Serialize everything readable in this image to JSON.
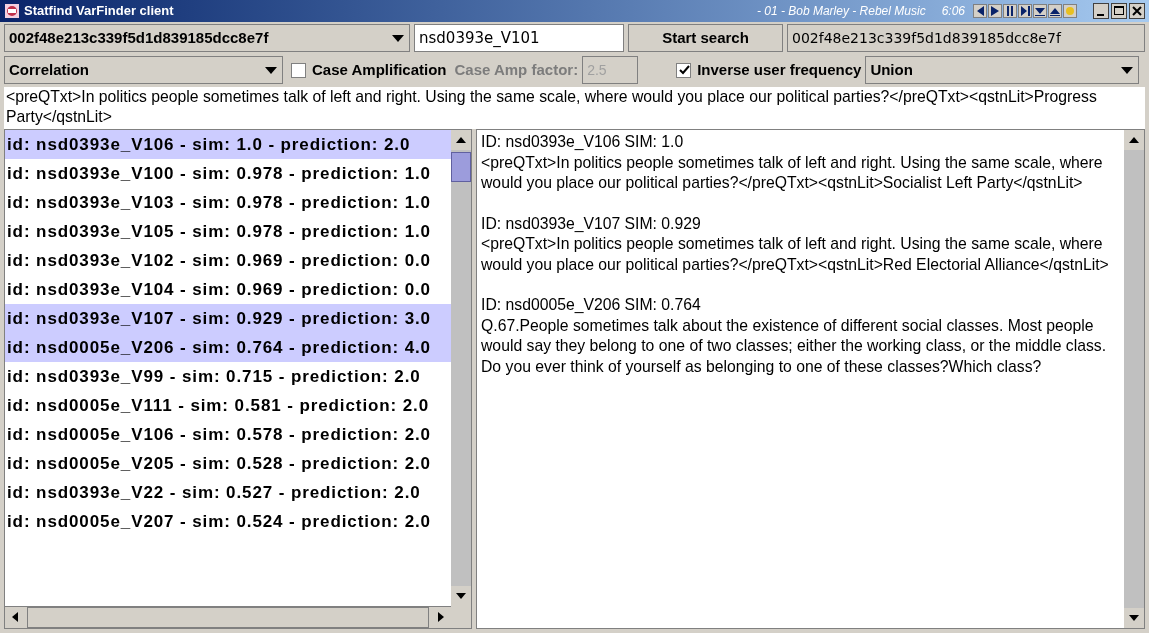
{
  "window": {
    "title": "Statfind VarFinder client",
    "now_playing": "- 01 - Bob Marley - Rebel Music",
    "time": "6:06"
  },
  "search_bar": {
    "user_combo": "002f48e213c339f5d1d839185dcc8e7f",
    "query_field": "nsd0393e_V101",
    "start_button": "Start search",
    "user_field": "002f48e213c339f5d1d839185dcc8e7f"
  },
  "options": {
    "similarity_combo": "Correlation",
    "case_amplification": {
      "label": "Case Amplification",
      "checked": false
    },
    "case_amp_factor": {
      "label": "Case Amp factor:",
      "value": "2.5",
      "disabled": true
    },
    "inverse_user_frequency": {
      "label": "Inverse user frequency",
      "checked": true
    },
    "combine_combo": "Union"
  },
  "query_text": "<preQTxt>In politics people sometimes talk of left and right. Using the same scale, where would you place our political parties?</preQTxt><qstnLit>Progress Party</qstnLit>",
  "results": [
    {
      "label": "id: nsd0393e_V106 - sim: 1.0 - prediction: 2.0",
      "selected": true
    },
    {
      "label": "id: nsd0393e_V100 - sim: 0.978 - prediction: 1.0",
      "selected": false
    },
    {
      "label": "id: nsd0393e_V103 - sim: 0.978 - prediction: 1.0",
      "selected": false
    },
    {
      "label": "id: nsd0393e_V105 - sim: 0.978 - prediction: 1.0",
      "selected": false
    },
    {
      "label": "id: nsd0393e_V102 - sim: 0.969 - prediction: 0.0",
      "selected": false
    },
    {
      "label": "id: nsd0393e_V104 - sim: 0.969 - prediction: 0.0",
      "selected": false
    },
    {
      "label": "id: nsd0393e_V107 - sim: 0.929 - prediction: 3.0",
      "selected": true
    },
    {
      "label": "id: nsd0005e_V206 - sim: 0.764 - prediction: 4.0",
      "selected": true
    },
    {
      "label": "id: nsd0393e_V99 - sim: 0.715 - prediction: 2.0",
      "selected": false
    },
    {
      "label": "id: nsd0005e_V111 - sim: 0.581 - prediction: 2.0",
      "selected": false
    },
    {
      "label": "id: nsd0005e_V106 - sim: 0.578 - prediction: 2.0",
      "selected": false
    },
    {
      "label": "id: nsd0005e_V205 - sim: 0.528 - prediction: 2.0",
      "selected": false
    },
    {
      "label": "id: nsd0393e_V22 - sim: 0.527 - prediction: 2.0",
      "selected": false
    },
    {
      "label": "id: nsd0005e_V207 - sim: 0.524 - prediction: 2.0",
      "selected": false
    }
  ],
  "details": [
    {
      "header": "ID: nsd0393e_V106 SIM: 1.0",
      "text": "<preQTxt>In politics people sometimes talk of left and right. Using the same scale, where would you place our political parties?</preQTxt><qstnLit>Socialist Left Party</qstnLit>"
    },
    {
      "header": "ID: nsd0393e_V107 SIM: 0.929",
      "text": "<preQTxt>In politics people sometimes talk of left and right. Using the same scale, where would you place our political parties?</preQTxt><qstnLit>Red Electorial Alliance</qstnLit>"
    },
    {
      "header": "ID: nsd0005e_V206 SIM: 0.764",
      "text": "Q.67.People sometimes talk about the existence of different social classes. Most people would say they belong to one of two classes; either the working class, or the middle class. Do you ever think of yourself as belonging to one of these classes?Which class?"
    }
  ]
}
